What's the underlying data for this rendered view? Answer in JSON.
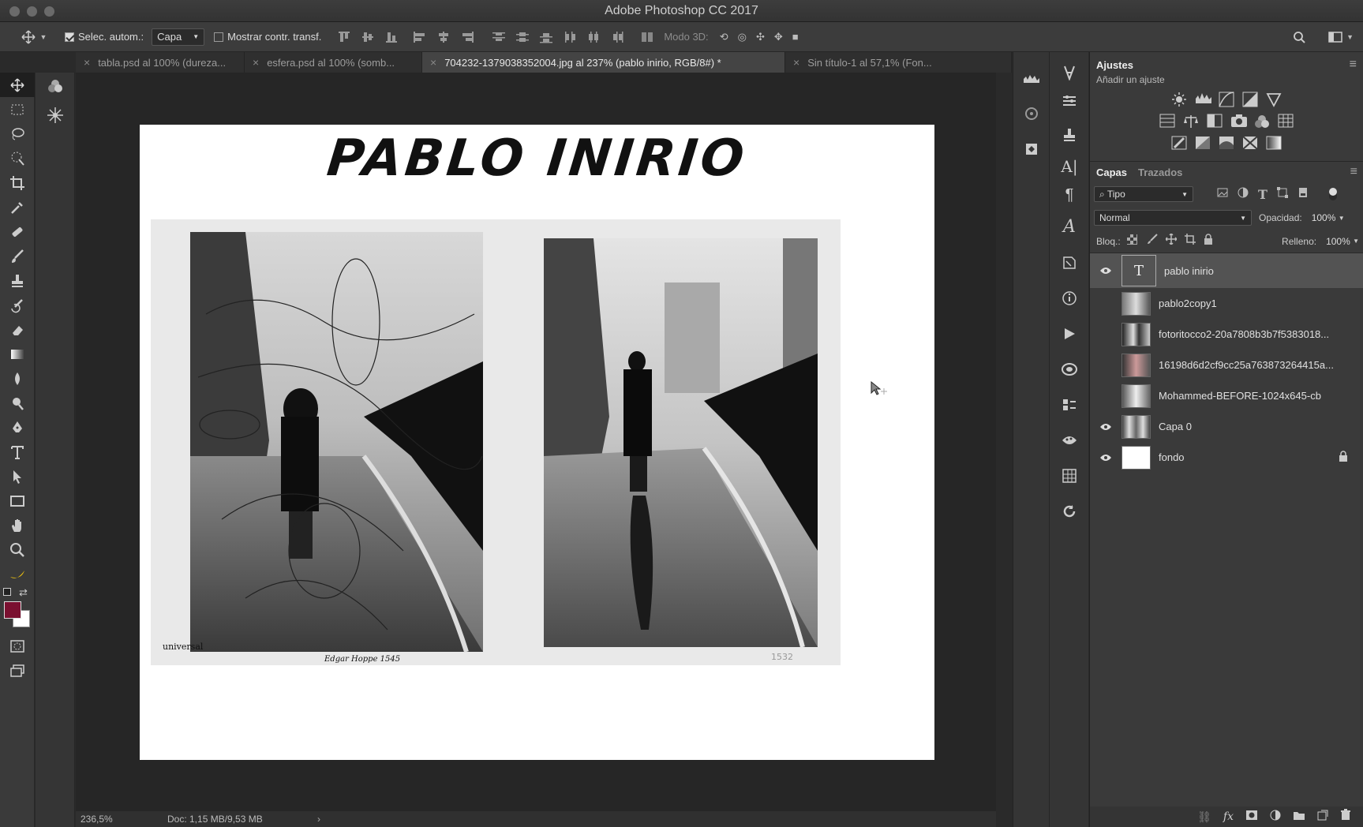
{
  "window": {
    "title": "Adobe Photoshop CC 2017"
  },
  "options": {
    "auto_select_label": "Selec. autom.:",
    "auto_select_value": "Capa",
    "show_transform_label": "Mostrar contr. transf.",
    "mode3d_label": "Modo 3D:"
  },
  "tabs": [
    {
      "label": "tabla.psd al 100% (dureza..."
    },
    {
      "label": "esfera.psd al 100% (somb..."
    },
    {
      "label": "704232-1379038352004.jpg al 237% (pablo inirio, RGB/8#) *"
    },
    {
      "label": "Sin título-1 al 57,1% (Fon..."
    }
  ],
  "document": {
    "title_text": "PABLO INIRIO",
    "stamp_text": "1532",
    "caption_left": "universal",
    "caption_right": "Edgar Hoppe 1545"
  },
  "status": {
    "zoom": "236,5%",
    "doc": "Doc: 1,15 MB/9,53 MB"
  },
  "colors": {
    "foreground": "#7a1030",
    "background": "#ffffff"
  },
  "adjustments": {
    "title": "Ajustes",
    "subtitle": "Añadir un ajuste"
  },
  "layers_panel": {
    "tab_layers": "Capas",
    "tab_paths": "Trazados",
    "filter_kind": "Tipo",
    "blend_mode": "Normal",
    "opacity_label": "Opacidad:",
    "opacity_value": "100%",
    "lock_label": "Bloq.:",
    "fill_label": "Relleno:",
    "fill_value": "100%",
    "layers": [
      {
        "name": "pablo inirio",
        "visible": true,
        "type": "text"
      },
      {
        "name": "pablo2copy1",
        "visible": false,
        "type": "image"
      },
      {
        "name": "fotoritocco2-20a7808b3b7f5383018...",
        "visible": false,
        "type": "image"
      },
      {
        "name": "16198d6d2cf9cc25a763873264415a...",
        "visible": false,
        "type": "image"
      },
      {
        "name": "Mohammed-BEFORE-1024x645-cb",
        "visible": false,
        "type": "image"
      },
      {
        "name": "Capa 0",
        "visible": true,
        "type": "image"
      },
      {
        "name": "fondo",
        "visible": true,
        "type": "fill",
        "locked": true
      }
    ]
  }
}
